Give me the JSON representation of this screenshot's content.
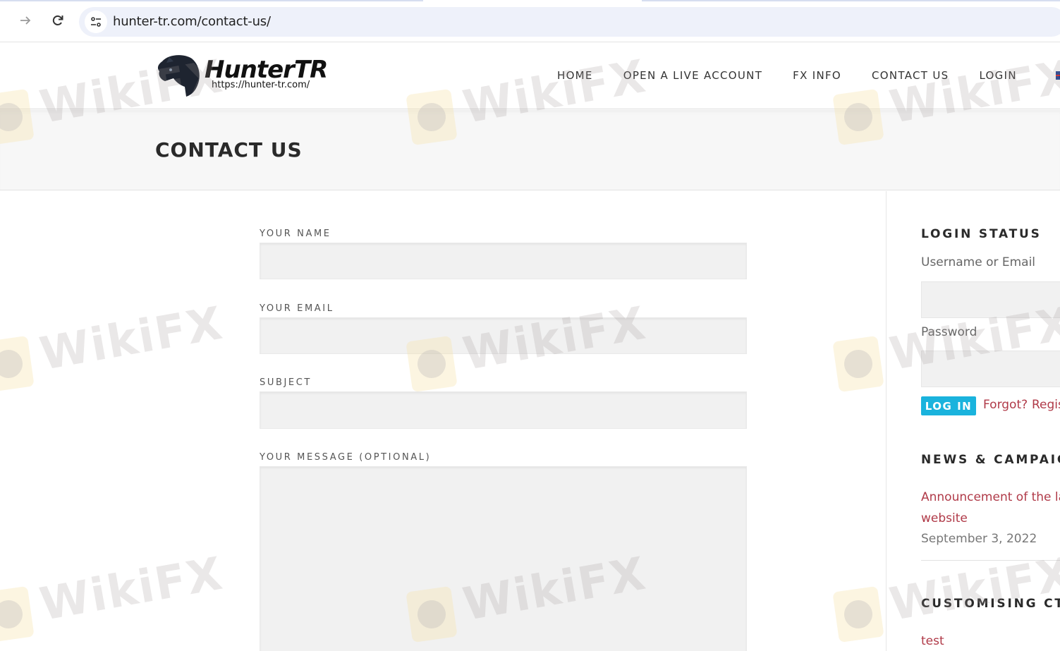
{
  "browser": {
    "url": "hunter-tr.com/contact-us/",
    "forward_icon": "arrow-right-icon",
    "reload_icon": "reload-icon",
    "site_info_icon": "tune-icon"
  },
  "header": {
    "logo_title": "HunterTR",
    "logo_url": "https://hunter-tr.com/",
    "nav": [
      {
        "label": "HOME"
      },
      {
        "label": "OPEN A LIVE ACCOUNT"
      },
      {
        "label": "FX INFO"
      },
      {
        "label": "CONTACT US"
      },
      {
        "label": "LOGIN"
      }
    ],
    "language_icon": "uk-flag-icon"
  },
  "page": {
    "title": "CONTACT US"
  },
  "form": {
    "name_label": "YOUR NAME",
    "name_value": "",
    "email_label": "YOUR EMAIL",
    "email_value": "",
    "subject_label": "SUBJECT",
    "subject_value": "",
    "message_label": "YOUR MESSAGE (OPTIONAL)",
    "message_value": ""
  },
  "sidebar": {
    "login": {
      "title": "LOGIN STATUS",
      "username_label": "Username or Email",
      "username_value": "",
      "password_label": "Password",
      "password_value": "",
      "login_button": "LOG IN",
      "forgot_link": "Forgot?",
      "register_link": "Register"
    },
    "news": {
      "title": "NEWS & CAMPAIGNS",
      "items": [
        {
          "title_line1": "Announcement of the launch of the new",
          "title_line2": "website",
          "date": "September 3, 2022"
        }
      ]
    },
    "customising": {
      "title": "CUSTOMISING CTRADER",
      "items": [
        {
          "label": "test"
        }
      ]
    }
  },
  "watermark": {
    "text": "WikiFX"
  },
  "colors": {
    "accent_button": "#1ab3dd",
    "link": "#b03a48"
  }
}
